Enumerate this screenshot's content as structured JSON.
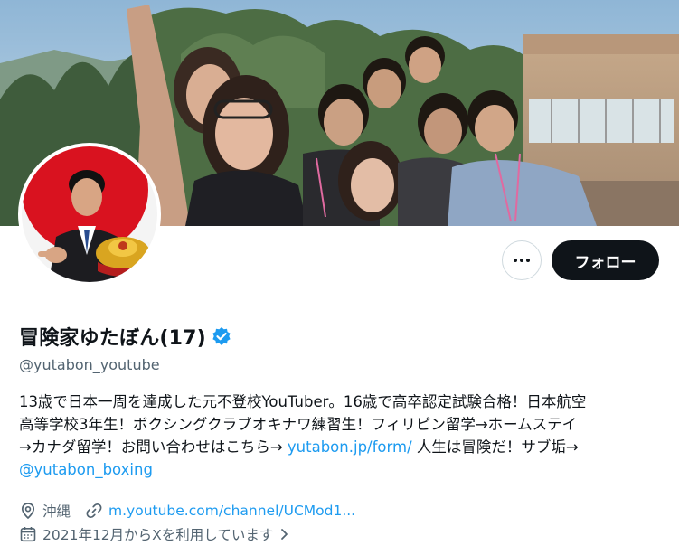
{
  "profile": {
    "display_name": "冒険家ゆたぼん(17)",
    "handle": "@yutabon_youtube",
    "verified_icon": "verified-badge-icon",
    "bio": {
      "line1": "13歳で日本一周を達成した元不登校YouTuber。16歳で高卒認定試験合格！日本航空",
      "line2": "高等学校3年生！ボクシングクラブオキナワ練習生！フィリピン留学→ホームステイ",
      "line3_before": "→カナダ留学！お問い合わせはこちら→ ",
      "line3_link": "yutabon.jp/form/",
      "line3_after": " 人生は冒険だ！サブ垢→",
      "line4_link": "@yutabon_boxing"
    },
    "location": "沖縄",
    "website": "m.youtube.com/channel/UCMod1...",
    "joined": "2021年12月からXを利用しています"
  },
  "actions": {
    "more_label": "",
    "follow_label": "フォロー"
  },
  "colors": {
    "accent": "#1d9bf0",
    "follow_bg": "#0f1419",
    "secondary_text": "#536471"
  }
}
